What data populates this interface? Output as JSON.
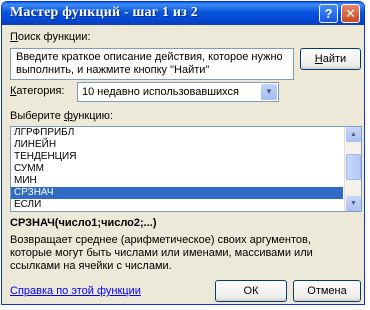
{
  "window": {
    "title": "Мастер функций - шаг 1 из 2",
    "help_label": "?",
    "close_label": "✕"
  },
  "search": {
    "label_prefix": "П",
    "label_rest": "оиск функции:",
    "text": "Введите краткое описание действия, которое нужно выполнить, и нажмите кнопку \"Найти\"",
    "find_prefix": "Н",
    "find_rest": "айти"
  },
  "category": {
    "label_prefix": "К",
    "label_rest": "атегория:",
    "selected": "10 недавно использовавшихся"
  },
  "functions": {
    "label_prefix": "Выберите ",
    "label_u": "ф",
    "label_rest": "ункцию:",
    "items": [
      "ЛГРФПРИБЛ",
      "ЛИНЕЙН",
      "ТЕНДЕНЦИЯ",
      "СУММ",
      "МИН",
      "СРЗНАЧ",
      "ЕСЛИ"
    ],
    "selected_index": 5
  },
  "selected_function": {
    "signature": "СРЗНАЧ(число1;число2;...)",
    "description": "Возвращает среднее (арифметическое) своих аргументов, которые могут быть числами или именами, массивами или ссылками на ячейки с числами."
  },
  "footer": {
    "help_link": "Справка по этой функции",
    "ok_label": "ОК",
    "cancel_label": "Отмена"
  }
}
